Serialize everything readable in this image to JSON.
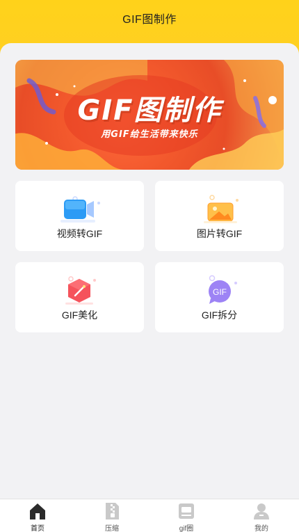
{
  "header": {
    "title": "GIF图制作"
  },
  "banner": {
    "title": "GIF图制作",
    "subtitle": "用GIF给生活带来快乐"
  },
  "features": [
    {
      "label": "视频转GIF",
      "icon": "video-icon"
    },
    {
      "label": "图片转GIF",
      "icon": "image-icon"
    },
    {
      "label": "GIF美化",
      "icon": "magic-wand-icon"
    },
    {
      "label": "GIF拆分",
      "icon": "gif-split-icon",
      "icon_text": "GIF"
    }
  ],
  "tabbar": {
    "items": [
      {
        "label": "首页",
        "icon": "home-icon",
        "active": true
      },
      {
        "label": "压缩",
        "icon": "compress-icon",
        "active": false
      },
      {
        "label": "gif圈",
        "icon": "gif-circle-icon",
        "active": false
      },
      {
        "label": "我的",
        "icon": "profile-icon",
        "active": false
      }
    ]
  },
  "colors": {
    "brand_yellow": "#ffd21a",
    "banner_red": "#ef5a2e",
    "background": "#f2f2f4"
  }
}
